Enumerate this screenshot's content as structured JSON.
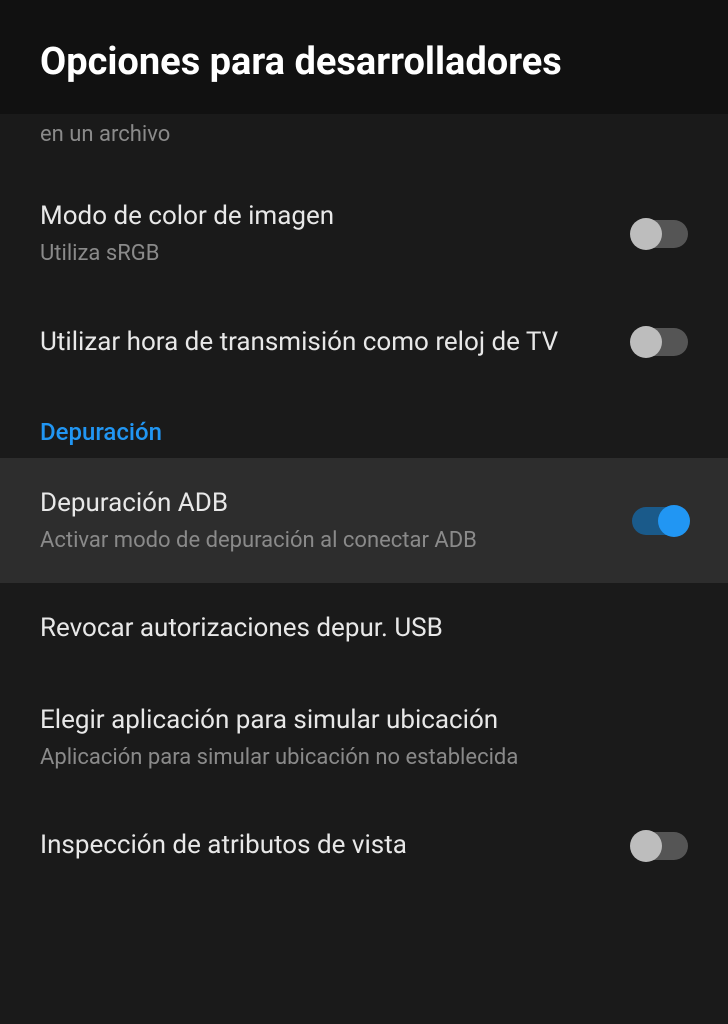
{
  "header": {
    "title": "Opciones para desarrolladores"
  },
  "partial": {
    "text": "en un archivo"
  },
  "items": [
    {
      "title": "Modo de color de imagen",
      "subtitle": "Utiliza sRGB",
      "toggle": "off"
    },
    {
      "title": "Utilizar hora de transmisión como reloj de TV",
      "subtitle": null,
      "toggle": "off"
    }
  ],
  "section": {
    "label": "Depuración"
  },
  "debug_items": [
    {
      "title": "Depuración ADB",
      "subtitle": "Activar modo de depuración al conectar ADB",
      "toggle": "on",
      "highlighted": true
    },
    {
      "title": "Revocar autorizaciones depur. USB",
      "subtitle": null,
      "toggle": null
    },
    {
      "title": "Elegir aplicación para simular ubicación",
      "subtitle": "Aplicación para simular ubicación no establecida",
      "toggle": null
    },
    {
      "title": "Inspección de atributos de vista",
      "subtitle": null,
      "toggle": "off"
    }
  ]
}
